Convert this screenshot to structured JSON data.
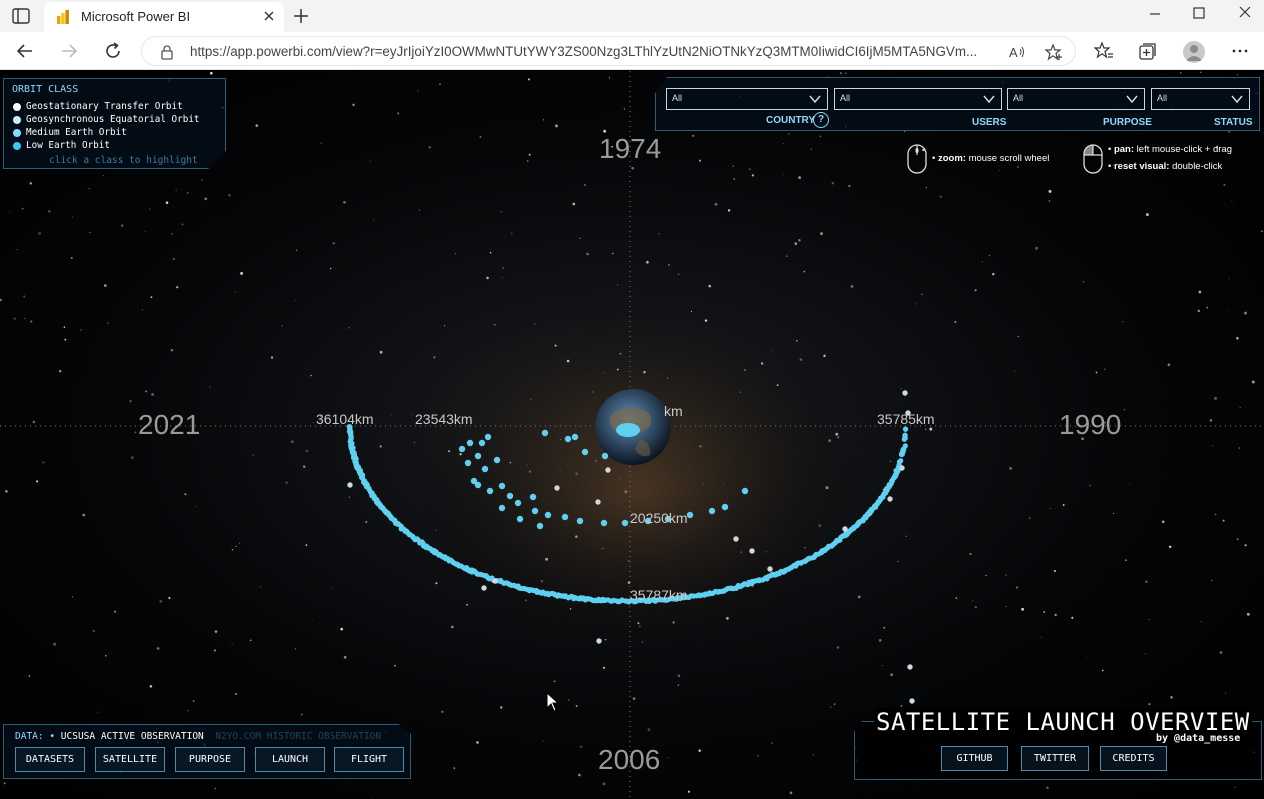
{
  "browser": {
    "tab_title": "Microsoft Power BI",
    "url": "https://app.powerbi.com/view?r=eyJrIjoiYzI0OWMwNTUtYWY3ZS00Nzg3LThlYzUtN2NiOTNkYzQ3MTM0IiwidCI6IjM5MTA5NGVm...",
    "icons": [
      "tab-actions-icon",
      "power-bi-logo-icon",
      "close-tab-icon",
      "new-tab-icon",
      "minimize-icon",
      "maximize-icon",
      "close-window-icon",
      "back-icon",
      "forward-icon",
      "refresh-icon",
      "lock-icon",
      "read-aloud-icon",
      "add-favorite-icon",
      "favorites-icon",
      "collections-icon",
      "profile-icon",
      "more-icon"
    ]
  },
  "legend": {
    "title": "ORBIT CLASS",
    "items": [
      {
        "label": "Geostationary Transfer Orbit",
        "color": "#ffffff"
      },
      {
        "label": "Geosynchronous Equatorial Orbit",
        "color": "#c8f0ff"
      },
      {
        "label": "Medium Earth Orbit",
        "color": "#7fdcff"
      },
      {
        "label": "Low Earth Orbit",
        "color": "#3cc6f0"
      }
    ],
    "hint": "click a class to highlight"
  },
  "filters": [
    {
      "label": "COUNTRY",
      "value": "All"
    },
    {
      "label": "USERS",
      "value": "All"
    },
    {
      "label": "PURPOSE",
      "value": "All"
    },
    {
      "label": "STATUS",
      "value": "All"
    }
  ],
  "help_symbol": "?",
  "controls": {
    "zoom_key": "zoom:",
    "zoom_value": "mouse scroll wheel",
    "pan_key": "pan:",
    "pan_value": "left mouse-click + drag",
    "reset_key": "reset visual:",
    "reset_value": "double-click"
  },
  "years": {
    "top": "1974",
    "left": "2021",
    "right": "1990",
    "bottom": "2006"
  },
  "distance_labels": {
    "a": "36104km",
    "b": "23543km",
    "c": "35785km",
    "d": "20250km",
    "e": "35787km",
    "f": "km"
  },
  "data_source": {
    "prefix": "DATA:",
    "active": "UCSUSA ACTIVE OBSERVATION",
    "inactive": "N2YO.COM HISTORIC OBSERVATION"
  },
  "nav_buttons": [
    "DATASETS",
    "SATELLITE",
    "PURPOSE",
    "LAUNCH",
    "FLIGHT"
  ],
  "title": "SATELLITE LAUNCH OVERVIEW",
  "byline": "by @data_messe",
  "link_buttons": [
    "GITHUB",
    "TWITTER",
    "CREDITS"
  ],
  "colors": {
    "accent": "#8fd8ff",
    "satellite": "#5fd0f0",
    "panel_border": "#2c5c76"
  }
}
